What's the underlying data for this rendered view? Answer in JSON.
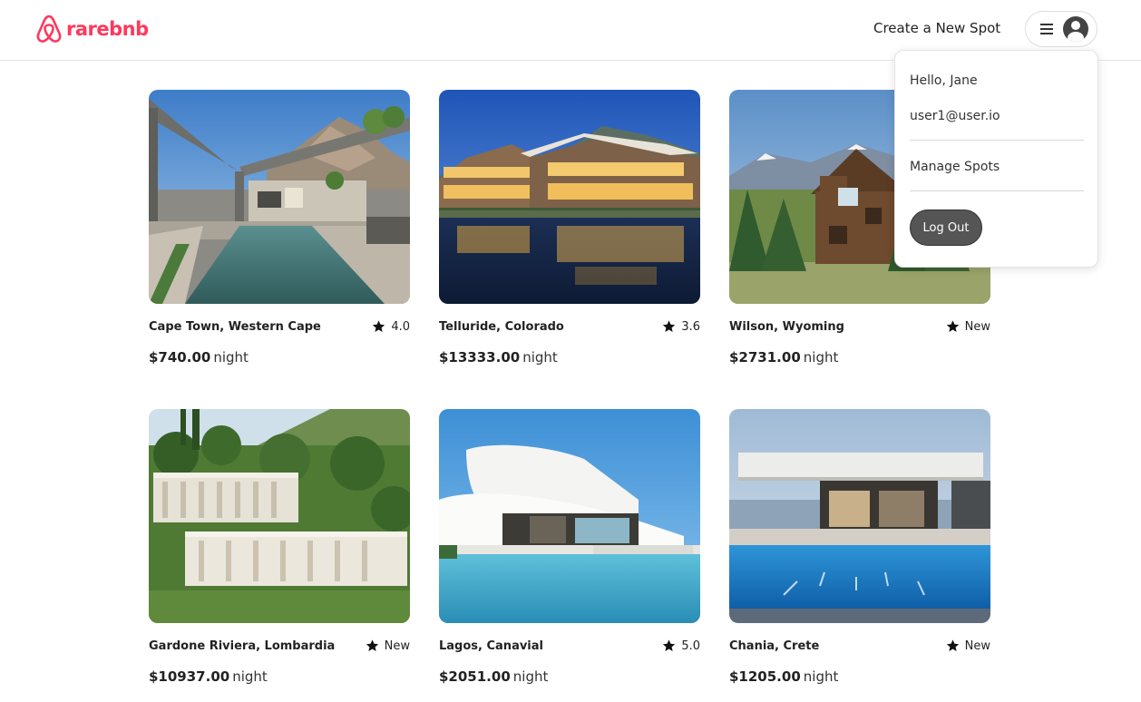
{
  "header": {
    "logo_text": "rarebnb",
    "create_link": "Create a New Spot"
  },
  "menu": {
    "greeting": "Hello, Jane",
    "email": "user1@user.io",
    "manage": "Manage Spots",
    "logout": "Log Out"
  },
  "colors": {
    "brand": "#ff385c",
    "logout_bg": "#555555"
  },
  "spots": [
    {
      "location": "Cape Town, Western Cape",
      "rating": "4.0",
      "price": "$740.00",
      "unit": "night"
    },
    {
      "location": "Telluride, Colorado",
      "rating": "3.6",
      "price": "$13333.00",
      "unit": "night"
    },
    {
      "location": "Wilson, Wyoming",
      "rating": "New",
      "price": "$2731.00",
      "unit": "night"
    },
    {
      "location": "Gardone Riviera, Lombardia",
      "rating": "New",
      "price": "$10937.00",
      "unit": "night"
    },
    {
      "location": "Lagos, Canavial",
      "rating": "5.0",
      "price": "$2051.00",
      "unit": "night"
    },
    {
      "location": "Chania, Crete",
      "rating": "New",
      "price": "$1205.00",
      "unit": "night"
    }
  ]
}
